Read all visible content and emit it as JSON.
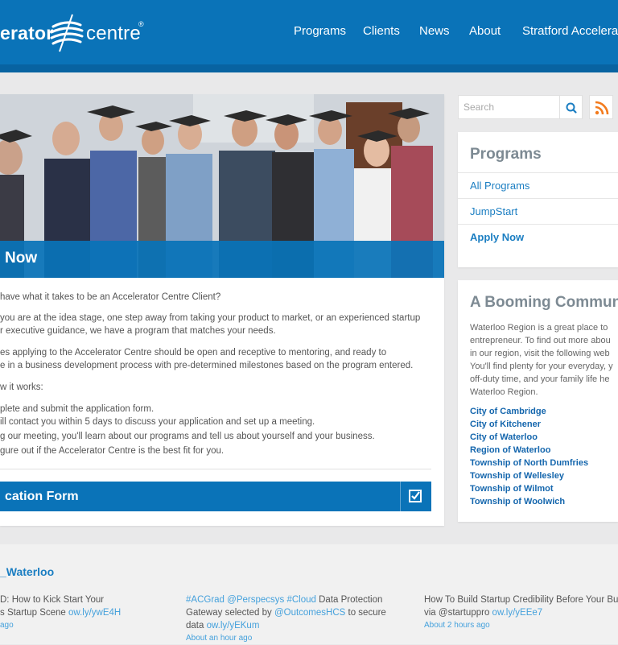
{
  "header": {
    "logo_word_left": "erator",
    "logo_word_right": "centre",
    "logo_reg": "®",
    "nav": [
      "Programs",
      "Clients",
      "News",
      "About",
      "Stratford Accelerator"
    ]
  },
  "hero": {
    "banner_text": "Now"
  },
  "body": {
    "intro": "have what it takes to be an Accelerator Centre Client?",
    "p2": [
      "you are at the idea stage, one step away from taking your product to market, or an experienced startup",
      "r executive guidance, we have a program that matches your needs."
    ],
    "p3": [
      "es applying to the Accelerator Centre should be open and receptive to mentoring, and ready to",
      "e in a business development process with pre-determined milestones based on the program entered."
    ],
    "how": "w it works:",
    "steps": [
      "plete and submit the application form.",
      "ill contact you within 5 days to discuss your application and set up a meeting.",
      "g our meeting, you'll learn about our programs and tell us about yourself and your business.",
      "gure out if the Accelerator Centre is the best fit for you."
    ],
    "form_label": "cation Form"
  },
  "sidebar": {
    "search_placeholder": "Search",
    "programs_title": "Programs",
    "program_links": [
      "All Programs",
      "JumpStart",
      "Apply Now"
    ],
    "community_title": "A Booming Community",
    "community_text": [
      "Waterloo Region is a great place to",
      "entrepreneur. To find out more abou",
      "in our region, visit the following web",
      "You'll find plenty for your everyday, y",
      "off-duty time, and your family life he",
      "Waterloo Region."
    ],
    "towns": [
      "City of Cambridge",
      "City of Kitchener",
      "City of Waterloo",
      "Region of Waterloo",
      "Township of North Dumfries",
      "Township of Wellesley",
      "Township of Wilmot",
      "Township of Woolwich"
    ]
  },
  "twitter": {
    "handle": "_Waterloo",
    "tweets": [
      {
        "lines": [
          "D: How to Kick Start Your",
          "s Startup Scene "
        ],
        "link": "ow.ly/ywE4H",
        "time": "ago"
      },
      {
        "tags": [
          "#ACGrad",
          "@Perspecsys",
          "#Cloud"
        ],
        "line1_rest": " Data Protection",
        "line2_pre": "Gateway selected by ",
        "mention": "@OutcomesHCS",
        "line2_post": " to secure",
        "line3_pre": "data ",
        "link": "ow.ly/yEKum",
        "time": "About an hour ago"
      },
      {
        "line1": "How To Build Startup Credibility Before Your Bu",
        "line2_pre": "via @startuppro ",
        "link": "ow.ly/yEEe7",
        "time": "About 2 hours ago"
      }
    ]
  },
  "colors": {
    "brand_blue": "#0a73b8",
    "link_blue": "#1b7ec2",
    "heading_gray": "#7d8a93",
    "rss_orange": "#f37b1d"
  }
}
